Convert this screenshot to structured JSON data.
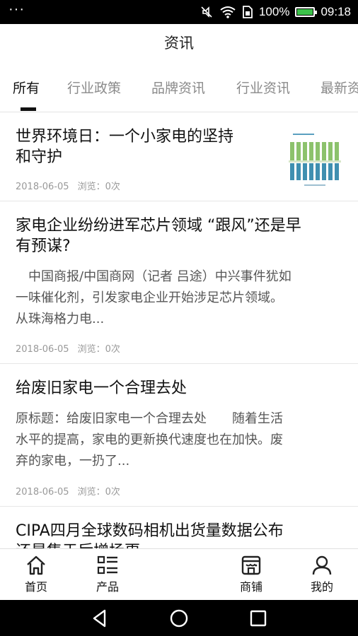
{
  "status_bar": {
    "dots": "···",
    "battery_percent": "100%",
    "time": "09:18",
    "icons": [
      "mute-icon",
      "wifi-icon",
      "sim-icon",
      "battery-charging-icon"
    ]
  },
  "header": {
    "title": "资讯"
  },
  "tabs": [
    {
      "label": "所有",
      "active": true
    },
    {
      "label": "行业政策",
      "active": false
    },
    {
      "label": "品牌资讯",
      "active": false
    },
    {
      "label": "行业资讯",
      "active": false
    },
    {
      "label": "最新资",
      "active": false
    }
  ],
  "articles": [
    {
      "title_lines": [
        "世界环境日：一个小家电的坚持",
        "和守护"
      ],
      "summary_lines": [],
      "date": "2018-06-05",
      "views": "浏览：0次",
      "has_thumbnail": true
    },
    {
      "title_lines": [
        "家电企业纷纷进军芯片领域 “跟风”还是早",
        "有预谋?"
      ],
      "summary_lines": [
        "　中国商报/中国商网（记者 吕途）中兴事件犹如",
        "一味催化剂，引发家电企业开始涉足芯片领域。",
        "从珠海格力电..."
      ],
      "date": "2018-06-05",
      "views": "浏览：0次",
      "has_thumbnail": false
    },
    {
      "title_lines": [
        "给废旧家电一个合理去处"
      ],
      "summary_lines": [
        "原标题：给废旧家电一个合理去处　　随着生活",
        "水平的提高，家电的更新换代速度也在加快。废",
        "弃的家电，一扔了..."
      ],
      "date": "2018-06-05",
      "views": "浏览：0次",
      "has_thumbnail": false
    },
    {
      "title_lines": [
        "CIPA四月全球数码相机出货量数据公布",
        "还是集于后增场更"
      ],
      "summary_lines": [],
      "date": "",
      "views": "",
      "has_thumbnail": false
    }
  ],
  "bottom_nav": [
    {
      "label": "首页",
      "icon": "home-icon"
    },
    {
      "label": "产品",
      "icon": "grid-list-icon"
    },
    {
      "label": "商铺",
      "icon": "store-icon"
    },
    {
      "label": "我的",
      "icon": "user-icon"
    }
  ],
  "system_nav": [
    "back-icon",
    "home-circle-icon",
    "recents-icon"
  ],
  "colors": {
    "active_tab": "#111111",
    "inactive_tab": "#8a8a8a",
    "meta": "#999999",
    "thumb_green": "#8cc26c",
    "thumb_blue": "#3f8fb0"
  }
}
